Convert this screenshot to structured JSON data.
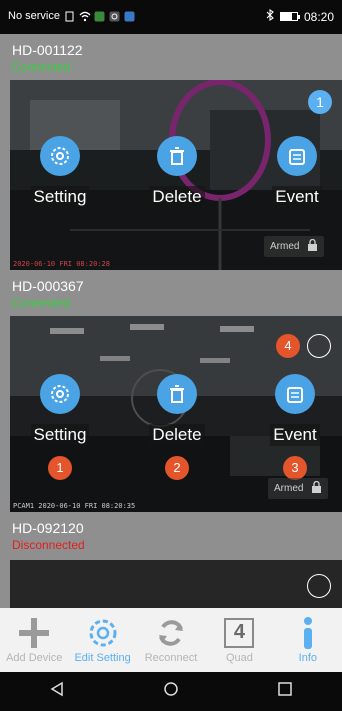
{
  "status_bar": {
    "carrier": "No service",
    "time": "08:20"
  },
  "cameras": [
    {
      "name": "HD-001122",
      "status": "Connected",
      "status_color": "#2fd43a",
      "actions": [
        "Setting",
        "Delete",
        "Event"
      ],
      "badge": "1",
      "armed": "Armed",
      "timestamp": "2020-06-10 FRI 08:20:28"
    },
    {
      "name": "HD-000367",
      "status": "Connected",
      "status_color": "#2fd43a",
      "actions": [
        "Setting",
        "Delete",
        "Event"
      ],
      "badge": "4",
      "callouts": [
        "1",
        "2",
        "3"
      ],
      "armed": "Armed",
      "timestamp": "PCAM1 2020-06-10 FRI 08:20:35"
    },
    {
      "name": "HD-092120",
      "status": "Disconnected",
      "status_color": "#e02020"
    }
  ],
  "toolbar": {
    "add_device": "Add Device",
    "edit_setting": "Edit Setting",
    "reconnect": "Reconnect",
    "quad": "Quad",
    "quad_number": "4",
    "info": "Info"
  },
  "colors": {
    "accent": "#4aa3e4",
    "callout": "#e4552b",
    "disabled": "#b5b5b5"
  }
}
